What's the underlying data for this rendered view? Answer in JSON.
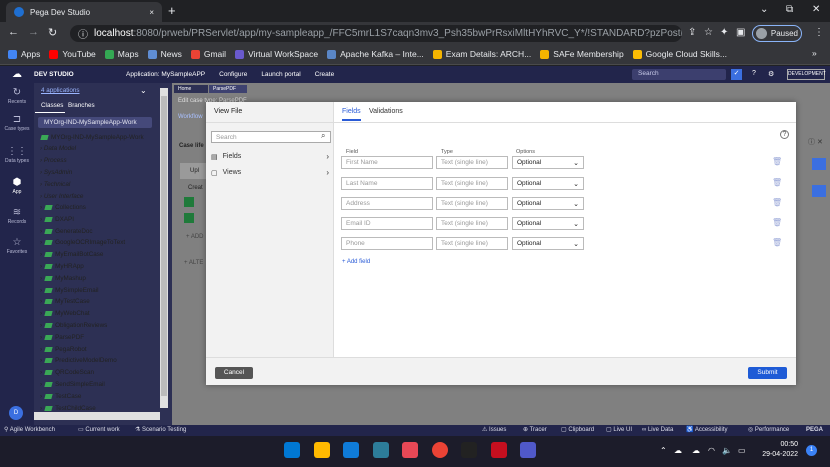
{
  "browser": {
    "tab_title": "Pega Dev Studio",
    "tab_close": "×",
    "new_tab": "+",
    "url_host": "localhost",
    "url_rest": ":8080/prweb/PRServlet/app/my-sampleapp_/FFC5mrL1S7caqn3mv3_Psh35bwPrRsxiMltHYhRVC_Y*/!STANDARD?pzPostD...",
    "profile_status": "Paused",
    "bookmarks": [
      "Apps",
      "YouTube",
      "Maps",
      "News",
      "Gmail",
      "Virtual WorkSpace",
      "Apache Kafka – Inte...",
      "Exam Details: ARCH...",
      "SAFe Membership",
      "Google Cloud Skills..."
    ],
    "bookmark_colors": [
      "#4285f4",
      "#ff0000",
      "#34a853",
      "#5f8dd3",
      "#ea4335",
      "#6a5acd",
      "#5a86c6",
      "#f4b400",
      "#f4b400",
      "#fbbc04"
    ],
    "more_bookmarks": "»"
  },
  "pega": {
    "studio": "DEV STUDIO",
    "application_label": "Application: MySampleAPP",
    "menus": [
      "Configure",
      "Launch portal",
      "Create"
    ],
    "search_placeholder": "Search",
    "mode_badge": "DEVELOPMENT",
    "rail": [
      {
        "label": "Recents",
        "icon": "↻"
      },
      {
        "label": "Case types",
        "icon": "⊐"
      },
      {
        "label": "Data types",
        "icon": "⋮⋮"
      },
      {
        "label": "App",
        "icon": "⬢"
      },
      {
        "label": "Records",
        "icon": "≋"
      },
      {
        "label": "Favorites",
        "icon": "☆"
      }
    ],
    "explorer": {
      "app_count": "4 applications",
      "tabs": [
        "Classes",
        "Branches"
      ],
      "class_selected": "MYOrg-IND-MySampleApp-Work",
      "root": "MYOrg-IND-MySampleApp-Work",
      "categories": [
        "Data Model",
        "Process",
        "SysAdmin",
        "Technical",
        "User Interface"
      ],
      "classes": [
        "Collections",
        "DXAPI",
        "GenerateDoc",
        "GoogleOCRImageToText",
        "MyEmailBotCase",
        "MyHRApp",
        "MyMashup",
        "MySimpleEmail",
        "MyTestCase",
        "MyWebChat",
        "ObligationReviews",
        "ParsePDF",
        "PegaRobot",
        "PredictiveModelDemo",
        "QRCodeScan",
        "SendSimpleEmail",
        "TestCase",
        "TestChildCase"
      ]
    },
    "workarea": {
      "tabs": [
        "Home",
        "ParsePDF"
      ],
      "edit_case": "Edit case type: ParsePDF",
      "workflow": "Workflow",
      "case_life": "Case life",
      "upload": "Upl",
      "create": "Creat",
      "add": "+ ADD",
      "alt": "+ ALTE"
    }
  },
  "modal": {
    "title": "View File",
    "search_placeholder": "Search",
    "side_items": [
      "Fields",
      "Views"
    ],
    "tabs": [
      "Fields",
      "Validations"
    ],
    "col_field": "Field",
    "col_type": "Type",
    "col_options": "Options",
    "rows": [
      {
        "field": "First Name",
        "type": "Text (single line)",
        "option": "Optional"
      },
      {
        "field": "Last Name",
        "type": "Text (single line)",
        "option": "Optional"
      },
      {
        "field": "Address",
        "type": "Text (single line)",
        "option": "Optional"
      },
      {
        "field": "Email ID",
        "type": "Text (single line)",
        "option": "Optional"
      },
      {
        "field": "Phone",
        "type": "Text (single line)",
        "option": "Optional"
      }
    ],
    "add_field": "+ Add field",
    "cancel": "Cancel",
    "submit": "Submit"
  },
  "devbar": {
    "left": [
      "Agile Workbench",
      "Current work",
      "Scenario Testing"
    ],
    "right": [
      "Issues",
      "Tracer",
      "Clipboard",
      "Live UI",
      "Live Data",
      "Accessibility",
      "Performance",
      "PEGA"
    ]
  },
  "taskbar": {
    "time": "00:50",
    "date": "29-04-2022",
    "notifications": "1",
    "app_colors": [
      "#0078d4",
      "#ffb900",
      "#0f7bd8",
      "#2d7d9a",
      "#e74856",
      "#ea4335",
      "#222",
      "#c50f1f",
      "#5059c9"
    ]
  }
}
